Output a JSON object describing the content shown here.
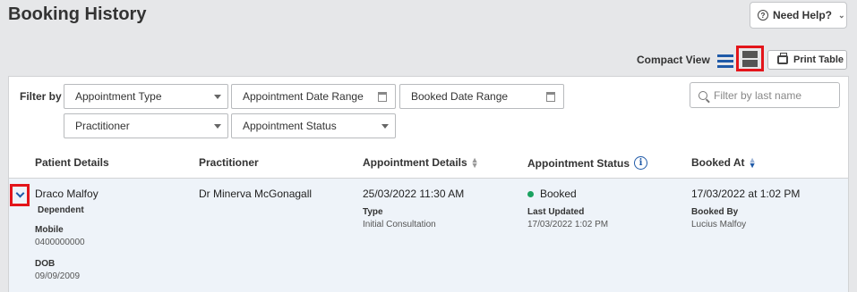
{
  "header": {
    "title": "Booking History",
    "help_label": "Need Help?"
  },
  "toolbar": {
    "compact_view_label": "Compact View",
    "print_label": "Print Table"
  },
  "filters": {
    "label": "Filter by",
    "appointment_type": "Appointment Type",
    "appointment_date_range": "Appointment Date Range",
    "booked_date_range": "Booked Date Range",
    "practitioner": "Practitioner",
    "appointment_status": "Appointment Status",
    "search_placeholder": "Filter by last name"
  },
  "table": {
    "columns": [
      "Patient Details",
      "Practitioner",
      "Appointment Details",
      "Appointment Status",
      "Booked At"
    ],
    "rows": [
      {
        "patient_name": "Draco Malfoy",
        "patient_type": "Dependent",
        "mobile_label": "Mobile",
        "mobile": "0400000000",
        "dob_label": "DOB",
        "dob": "09/09/2009",
        "practitioner": "Dr Minerva McGonagall",
        "appointment_datetime": "25/03/2022 11:30 AM",
        "type_label": "Type",
        "type": "Initial Consultation",
        "status": "Booked",
        "last_updated_label": "Last Updated",
        "last_updated": "17/03/2022 1:02 PM",
        "booked_at": "17/03/2022 at 1:02 PM",
        "booked_by_label": "Booked By",
        "booked_by": "Lucius Malfoy"
      }
    ]
  },
  "colors": {
    "accent": "#1f5aa8",
    "highlight": "#e3151a",
    "status_booked": "#1aa260",
    "row_bg": "#eef3f9"
  }
}
